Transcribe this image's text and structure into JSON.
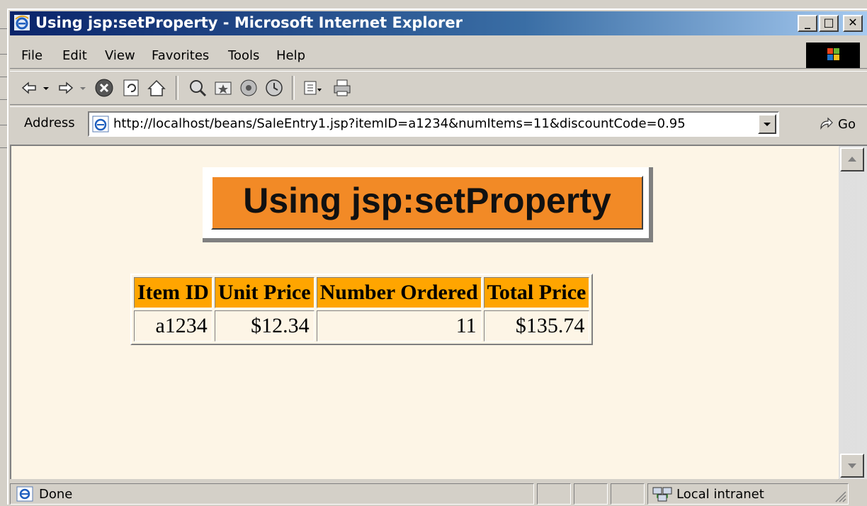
{
  "window": {
    "title": "Using jsp:setProperty - Microsoft Internet Explorer",
    "minimize_label": "_",
    "maximize_label": "□",
    "close_label": "✕"
  },
  "menu": {
    "items": [
      "File",
      "Edit",
      "View",
      "Favorites",
      "Tools",
      "Help"
    ]
  },
  "toolbar": {
    "icons": [
      "back-icon",
      "forward-icon",
      "stop-icon",
      "refresh-icon",
      "home-icon",
      "search-icon",
      "favorites-icon",
      "media-icon",
      "history-icon",
      "mail-icon",
      "print-icon"
    ]
  },
  "address": {
    "label": "Address",
    "url": "http://localhost/beans/SaleEntry1.jsp?itemID=a1234&numItems=11&discountCode=0.95",
    "go_label": "Go"
  },
  "page": {
    "heading": "Using jsp:setProperty",
    "table": {
      "headers": [
        "Item ID",
        "Unit Price",
        "Number Ordered",
        "Total Price"
      ],
      "rows": [
        [
          "a1234",
          "$12.34",
          "11",
          "$135.74"
        ]
      ]
    }
  },
  "status": {
    "text": "Done",
    "zone": "Local intranet"
  },
  "colors": {
    "heading_bg": "#f28a26",
    "table_header_bg": "#ffa500",
    "page_bg": "#fdf5e6",
    "titlebar": "#0a246a"
  }
}
